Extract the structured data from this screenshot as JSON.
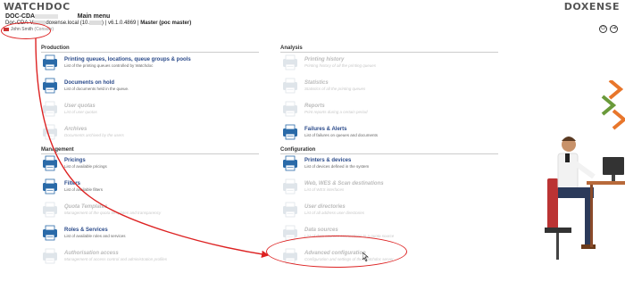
{
  "brand": {
    "left": "WATCHDOC",
    "right": "DOXENSE"
  },
  "header": {
    "server": "DOC-CDA",
    "menu_title": "Main menu",
    "line2_prefix": "Doc-CDA-V",
    "line2_mid": "doxense.local (10.",
    "line2_version": "v6.1.0.4869",
    "line2_mode": "Master (poc master)"
  },
  "user": {
    "name": "John Smith",
    "status": "(Console)"
  },
  "header_icons": [
    "power-icon",
    "logout-icon"
  ],
  "sections": {
    "production": {
      "title": "Production",
      "items": [
        {
          "title": "Printing queues, locations, queue groups & pools",
          "desc": "List of the printing queues controlled by Watchdoc",
          "enabled": true,
          "icon": "printer-icon"
        },
        {
          "title": "Documents on hold",
          "desc": "List of documents held in the queue.",
          "enabled": true,
          "icon": "document-icon"
        },
        {
          "title": "User quotas",
          "desc": "List of user quotas",
          "enabled": false,
          "icon": "user-quota-icon"
        },
        {
          "title": "Archives",
          "desc": "Documents archived by the users",
          "enabled": false,
          "icon": "archive-icon"
        }
      ]
    },
    "analysis": {
      "title": "Analysis",
      "items": [
        {
          "title": "Printing history",
          "desc": "Printing history of all the printing queues",
          "enabled": false,
          "icon": "history-icon"
        },
        {
          "title": "Statistics",
          "desc": "Statistics of all the printing queues",
          "enabled": false,
          "icon": "statistics-icon"
        },
        {
          "title": "Reports",
          "desc": "Print reports during a certain period",
          "enabled": false,
          "icon": "reports-icon"
        },
        {
          "title": "Failures & Alerts",
          "desc": "List of failures on queues and documents",
          "enabled": true,
          "icon": "alert-printer-icon"
        }
      ]
    },
    "management": {
      "title": "Management",
      "items": [
        {
          "title": "Pricings",
          "desc": "List of available pricings",
          "enabled": true,
          "icon": "pricing-icon"
        },
        {
          "title": "Filters",
          "desc": "List of available filters",
          "enabled": true,
          "icon": "filter-icon"
        },
        {
          "title": "Quota Templates",
          "desc": "Management of the quota templates and transparency",
          "enabled": false,
          "icon": "quota-template-icon"
        },
        {
          "title": "Roles & Services",
          "desc": "List of available roles and services",
          "enabled": true,
          "icon": "roles-icon"
        },
        {
          "title": "Authorisation access",
          "desc": "Management of access control and administration profiles",
          "enabled": false,
          "icon": "access-icon"
        }
      ]
    },
    "configuration": {
      "title": "Configuration",
      "items": [
        {
          "title": "Printers & devices",
          "desc": "List of devices defined in the system",
          "enabled": true,
          "icon": "printer-config-icon"
        },
        {
          "title": "Web, WES & Scan destinations",
          "desc": "List of WES interfaces",
          "enabled": false,
          "icon": "web-icon"
        },
        {
          "title": "User directories",
          "desc": "List of all address user directories",
          "enabled": false,
          "icon": "directory-icon"
        },
        {
          "title": "Data sources",
          "desc": "List of data sources connections to a quota source",
          "enabled": false,
          "icon": "database-icon"
        },
        {
          "title": "Advanced configuration",
          "desc": "Configuration and settings of the Watchdoc server",
          "enabled": false,
          "icon": "gears-icon"
        }
      ]
    }
  },
  "colors": {
    "accent": "#2a4a8a",
    "highlight": "#d22222",
    "brand_orange": "#e8762b",
    "brand_green": "#6a9a3a"
  }
}
